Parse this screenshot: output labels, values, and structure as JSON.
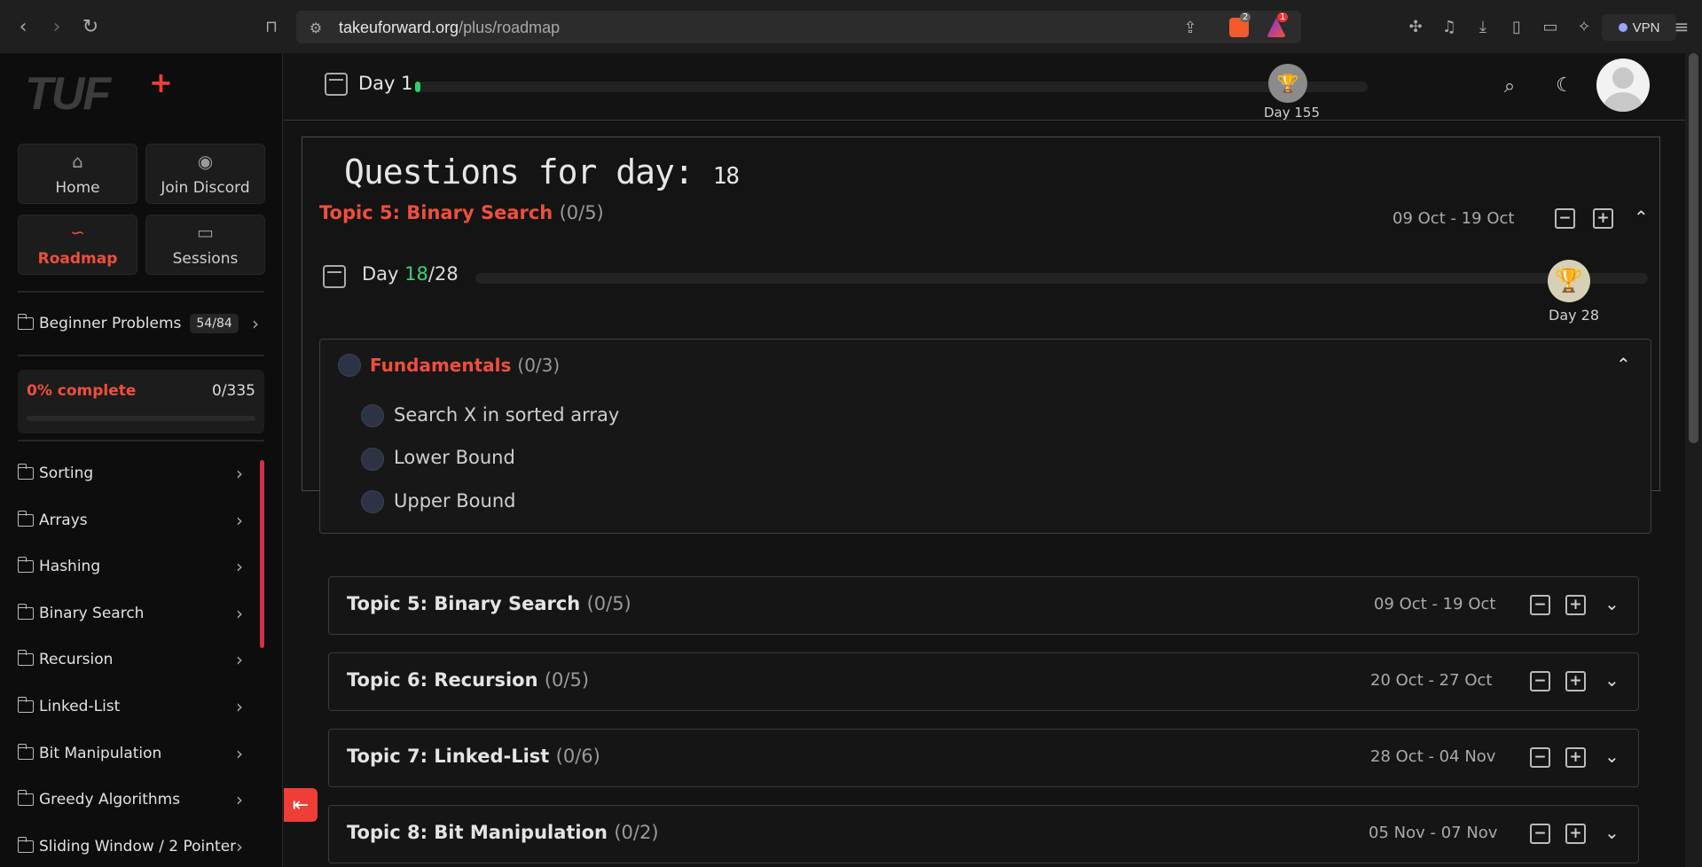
{
  "browser": {
    "url_host": "takeuforward.org",
    "url_path": "/plus/roadmap",
    "brave_badge": "2",
    "alert_badge": "1",
    "vpn_label": "VPN"
  },
  "sidebar": {
    "logo": "TUF",
    "logo_plus": "+",
    "nav": [
      {
        "label": "Home",
        "icon": "home-icon"
      },
      {
        "label": "Join Discord",
        "icon": "discord-icon"
      },
      {
        "label": "Roadmap",
        "icon": "roadmap-icon",
        "active": true
      },
      {
        "label": "Sessions",
        "icon": "video-icon"
      }
    ],
    "beginner": {
      "label": "Beginner Problems",
      "count": "54/84"
    },
    "progress": {
      "title": "0% complete",
      "count": "0/335",
      "fraction": 0
    },
    "topics": [
      "Sorting",
      "Arrays",
      "Hashing",
      "Binary Search",
      "Recursion",
      "Linked-List",
      "Bit Manipulation",
      "Greedy Algorithms",
      "Sliding Window / 2 Pointer"
    ]
  },
  "topbar": {
    "day_label": "Day 1",
    "goal_label": "Day 155",
    "progress_fraction": 0.006
  },
  "overlay": {
    "title": "Questions for day:",
    "day_number": "18",
    "topic_title": "Topic 5: Binary Search",
    "topic_count": "(0/5)",
    "date_range": "09 Oct - 19 Oct",
    "day_word": "Day",
    "day_current": "18",
    "day_total": "/28",
    "goal_label": "Day 28",
    "section": {
      "title": "Fundamentals",
      "count": "(0/3)",
      "items": [
        "Search X in sorted array",
        "Lower Bound",
        "Upper Bound"
      ]
    }
  },
  "topics": [
    {
      "title": "Topic 5: Binary Search",
      "count": "(0/5)",
      "dates": "09 Oct - 19 Oct"
    },
    {
      "title": "Topic 6: Recursion",
      "count": "(0/5)",
      "dates": "20 Oct - 27 Oct"
    },
    {
      "title": "Topic 7: Linked-List",
      "count": "(0/6)",
      "dates": "28 Oct - 04 Nov"
    },
    {
      "title": "Topic 8: Bit Manipulation",
      "count": "(0/2)",
      "dates": "05 Nov - 07 Nov"
    }
  ],
  "colors": {
    "accent": "#ef4f3c",
    "progress_green": "#2fd06b",
    "trophy": "#e39a0d"
  }
}
